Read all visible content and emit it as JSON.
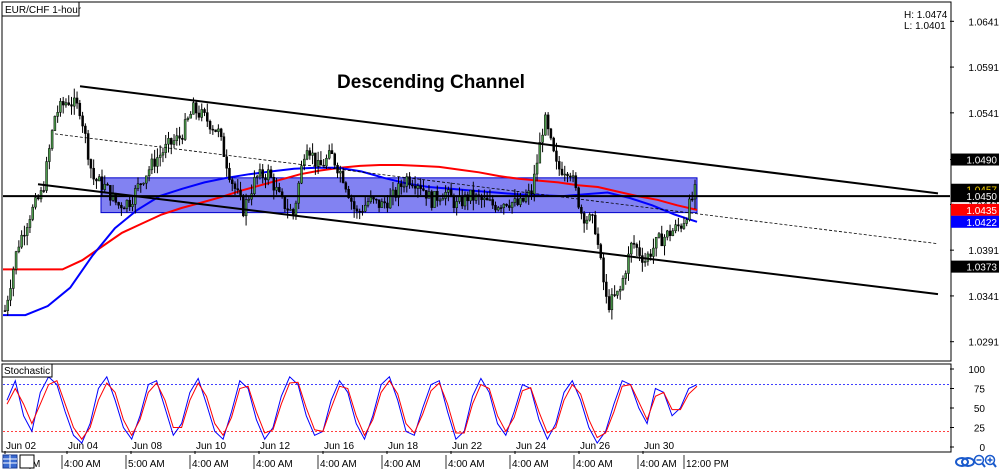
{
  "window": {
    "title": "EUR/CHF 1-hour"
  },
  "hl": {
    "high": "H: 1.0474",
    "low": "L: 1.0401"
  },
  "chart_data": [
    {
      "type": "line",
      "title": "Descending Channel",
      "symbol": "EUR/CHF 1-hour",
      "ylim": [
        1.0271,
        1.0661
      ],
      "y_ticks": [
        "1.0641",
        "1.0591",
        "1.0541",
        "1.0490",
        "1.0441",
        "1.0391",
        "1.0341",
        "1.0291"
      ],
      "x_ticks": [
        "Jun 02",
        "Jun 04",
        "Jun 08",
        "Jun 10",
        "Jun 12",
        "Jun 16",
        "Jun 18",
        "Jun 22",
        "Jun 24",
        "Jun 26",
        "Jun 30"
      ],
      "price_tags": [
        {
          "label": "1.0490",
          "value": 1.049,
          "color": "#000000",
          "text_color": "#ffffff"
        },
        {
          "label": "1.0457",
          "value": 1.0457,
          "color": "#000000",
          "text_color": "#ffd700"
        },
        {
          "label": "1.0450",
          "value": 1.045,
          "color": "#000000",
          "text_color": "#ffffff"
        },
        {
          "label": "1.0435",
          "value": 1.0435,
          "color": "#ff0000",
          "text_color": "#ffffff"
        },
        {
          "label": "1.0422",
          "value": 1.0422,
          "color": "#0000ff",
          "text_color": "#ffffff"
        },
        {
          "label": "1.0373",
          "value": 1.0373,
          "color": "#000000",
          "text_color": "#ffffff"
        }
      ],
      "price_series": [
        1.0325,
        1.0395,
        1.043,
        1.0455,
        1.054,
        1.0555,
        1.0545,
        1.047,
        1.046,
        1.044,
        1.0445,
        1.047,
        1.049,
        1.0505,
        1.0515,
        1.0545,
        1.0535,
        1.052,
        1.047,
        1.0435,
        1.047,
        1.0475,
        1.0445,
        1.043,
        1.051,
        1.048,
        1.0495,
        1.047,
        1.043,
        1.0445,
        1.044,
        1.045,
        1.047,
        1.0465,
        1.0445,
        1.0455,
        1.044,
        1.045,
        1.0445,
        1.044,
        1.0445,
        1.044,
        1.0455,
        1.0535,
        1.048,
        1.048,
        1.043,
        1.042,
        1.033,
        1.0345,
        1.04,
        1.038,
        1.04,
        1.041,
        1.042,
        1.0455
      ],
      "series": [
        {
          "name": "MA red",
          "color": "#ff0000",
          "values": [
            1.037,
            1.037,
            1.037,
            1.037,
            1.038,
            1.0395,
            1.041,
            1.042,
            1.043,
            1.0437,
            1.0443,
            1.0449,
            1.0456,
            1.0462,
            1.0468,
            1.0474,
            1.0478,
            1.0481,
            1.0483,
            1.0484,
            1.0484,
            1.0483,
            1.0482,
            1.0479,
            1.0476,
            1.0472,
            1.0469,
            1.0467,
            1.0465,
            1.0462,
            1.046,
            1.0455,
            1.045,
            1.0446,
            1.044,
            1.0435
          ]
        },
        {
          "name": "MA blue",
          "color": "#0000ff",
          "values": [
            1.032,
            1.032,
            1.033,
            1.035,
            1.0385,
            1.0415,
            1.0435,
            1.045,
            1.0458,
            1.0465,
            1.047,
            1.0474,
            1.0477,
            1.048,
            1.0481,
            1.0481,
            1.0477,
            1.047,
            1.0464,
            1.046,
            1.0458,
            1.0456,
            1.0454,
            1.0452,
            1.0451,
            1.045,
            1.0452,
            1.0454,
            1.0448,
            1.044,
            1.043,
            1.0422
          ]
        }
      ],
      "channel": {
        "upper": [
          1.057,
          1.0453
        ],
        "lower": [
          1.0463,
          1.0343
        ],
        "mid": [
          1.0518,
          1.0398
        ]
      },
      "zone": {
        "top": 1.047,
        "bottom": 1.0432
      },
      "horizontal_line": 1.045
    },
    {
      "type": "line",
      "title": "Stochastic",
      "ylim": [
        0,
        100
      ],
      "y_ticks": [
        "100",
        "75",
        "50",
        "25",
        "0"
      ],
      "levels": [
        80,
        20
      ],
      "series": [
        {
          "name": "%K",
          "color": "#0000ff",
          "values": [
            60,
            85,
            40,
            20,
            70,
            90,
            80,
            45,
            15,
            5,
            30,
            75,
            90,
            60,
            25,
            10,
            40,
            80,
            85,
            50,
            15,
            30,
            70,
            88,
            55,
            20,
            10,
            45,
            85,
            75,
            35,
            10,
            25,
            65,
            90,
            80,
            40,
            15,
            20,
            60,
            85,
            70,
            30,
            10,
            40,
            80,
            90,
            60,
            20,
            15,
            50,
            80,
            85,
            45,
            10,
            20,
            65,
            88,
            70,
            30,
            15,
            45,
            80,
            75,
            35,
            10,
            30,
            70,
            85,
            60,
            25,
            5,
            20,
            55,
            85,
            80,
            50,
            30,
            75,
            70,
            40,
            50,
            75,
            80
          ]
        },
        {
          "name": "%D",
          "color": "#ff0000",
          "values": [
            55,
            75,
            55,
            30,
            55,
            80,
            85,
            55,
            25,
            10,
            25,
            60,
            82,
            70,
            35,
            15,
            35,
            70,
            82,
            60,
            25,
            25,
            60,
            82,
            65,
            30,
            15,
            38,
            75,
            78,
            45,
            18,
            22,
            55,
            82,
            83,
            50,
            22,
            20,
            50,
            78,
            75,
            40,
            15,
            35,
            70,
            85,
            68,
            30,
            18,
            42,
            72,
            82,
            55,
            18,
            18,
            55,
            80,
            75,
            40,
            20,
            38,
            72,
            76,
            45,
            18,
            25,
            60,
            80,
            68,
            35,
            12,
            18,
            45,
            78,
            80,
            58,
            35,
            65,
            70,
            48,
            48,
            68,
            78
          ]
        }
      ]
    }
  ],
  "time_axis": {
    "labels": [
      "Jun 02",
      "Jun 04",
      "Jun 08",
      "Jun 10",
      "Jun 12",
      "Jun 16",
      "Jun 18",
      "Jun 22",
      "Jun 24",
      "Jun 26",
      "Jun 30"
    ],
    "bottom_labels": [
      "M",
      "4:00 AM",
      "5:00 AM",
      "4:00 AM",
      "4:00 AM",
      "4:00 AM",
      "4:00 AM",
      "4:00 AM",
      "4:00 AM",
      "4:00 AM",
      "4:00 AM",
      "12:00 PM"
    ]
  },
  "colors": {
    "zone_fill": "#6c6cf0",
    "zone_border": "#0000cc",
    "candle": "#000000",
    "candle_up": "#4a9a4a"
  },
  "icons": [
    "grid-icon",
    "link-icon",
    "zoom-out-icon",
    "zoom-in-icon"
  ]
}
